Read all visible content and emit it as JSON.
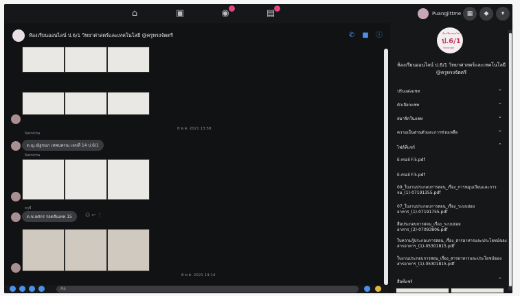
{
  "topbar": {
    "profile_name": "Puangjittme",
    "nav_icons": [
      "home-icon",
      "watch-icon",
      "groups-icon",
      "gaming-icon"
    ]
  },
  "chat": {
    "title": "ห้องเรียนออนไลน์ ป.6/1 วิทยาศาสตร์และเทคโนโลยี @ครูทรงจัตตรี",
    "timestamp_1": "8 พ.ค. 2021 13:58",
    "sender_1": "Natnicha",
    "message_1": "ด.ญ.ณัฐชนก เทพนพรณ เลขที่ 14 ป.6/1",
    "sender_2": "Natnicha",
    "sender_3": "ครูพี",
    "message_3": "ด.ช.ยศกร รอดสันเทพ 15",
    "timestamp_2": "8 พ.ค. 2021 14:14",
    "composer_placeholder": "Aa"
  },
  "panel": {
    "avatar_text_top": "ห้องเรียนออนไลน์",
    "avatar_text_main": "ป.6/1",
    "avatar_text_bottom": "วิทยาศาสตร์",
    "title": "ห้องเรียนออนไลน์ ป.6/1 วิทยาศาสตร์และเทคโนโลยี @ครูทรงจัตตรี",
    "sections": [
      "ปรับแต่งแชท",
      "ตัวเลือกแชท",
      "สมาชิกในแชท",
      "ความเป็นส่วนตัวและการช่วยเหลือ",
      "ไฟล์ที่แชร์",
      "สื่อที่แชร์"
    ],
    "files": [
      "E-mail F.5.pdf",
      "E-mail F.5.pdf",
      "09_ใบงานประกอบการสอน_เรื่อง_การหมุนเวียนและการจม_(1)-07191355.pdf",
      "07_ใบงานประกอบการสอน_เรื่อง_ระบบย่อยอาหาร_(1)-07191755.pdf",
      "สื่อประกอบการสอน_เรื่อง_ระบบย่อยอาหาร_(2)-07093806.pdf",
      "ใบความรู้ประกอบการสอน_เรื่อง_สารอาหารและประโยชน์ของสารอาหาร_(1)-05301815.pdf",
      "ใบงานประกอบการสอน_เรื่อง_สารอาหารและประโยชน์ของสารอาหาร_(1)-05301815.pdf"
    ]
  }
}
